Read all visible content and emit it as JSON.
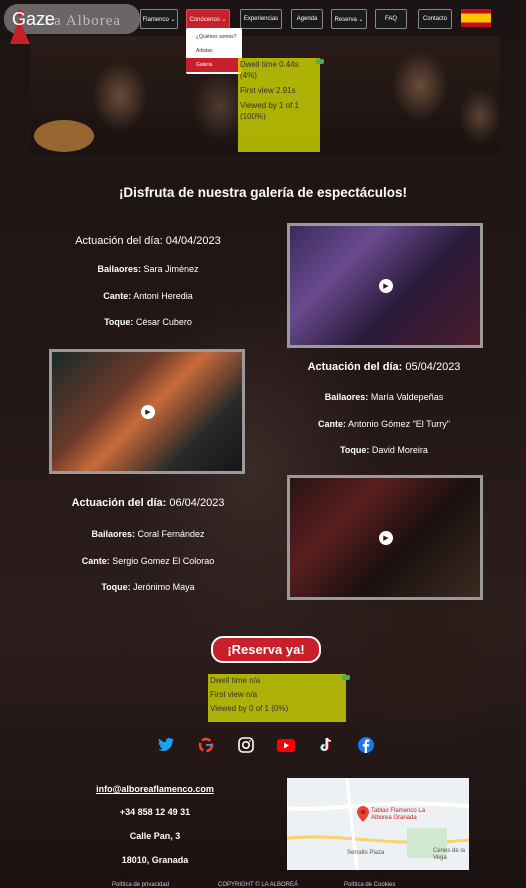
{
  "header": {
    "gaze_label": "Gaze",
    "brand": "La Alborea",
    "nav": [
      "Flamenco ⌄",
      "Conócenos ⌄",
      "Experiencias",
      "Agenda",
      "Reserva ⌄",
      "FAQ",
      "Contacto"
    ],
    "dropdown": [
      "¿Quiénes somos?",
      "Artistas",
      "Galería"
    ]
  },
  "overlay_top": {
    "dwell": "Dwell time 0.44s",
    "dwell_pct": "(4%)",
    "first": "First view 2.91s",
    "viewed": "Viewed by 1 of 1",
    "viewed_pct": "(100%)"
  },
  "overlay_bottom": {
    "dwell": "Dwell time n/a",
    "first": "First view n/a",
    "viewed": "Viewed by 0 of 1 (0%)"
  },
  "gallery": {
    "title": "¡Disfruta de nuestra galería de espectáculos!",
    "performances": [
      {
        "date_label": "Actuación del día:",
        "date": "04/04/2023",
        "bailaores_label": "Bailaores:",
        "bailaores": "Sara Jiménez",
        "cante_label": "Cante:",
        "cante": "Antoni Heredia",
        "toque_label": "Toque:",
        "toque": "César Cubero"
      },
      {
        "date_label": "Actuación del día:",
        "date": "05/04/2023",
        "bailaores_label": "Bailaores:",
        "bailaores": "María Valdepeñas",
        "cante_label": "Cante:",
        "cante": "Antonio Gómez \"El Turry\"",
        "toque_label": "Toque:",
        "toque": "David Moreira"
      },
      {
        "date_label": "Actuación del día:",
        "date": "06/04/2023",
        "bailaores_label": "Bailaores:",
        "bailaores": "Coral Fernández",
        "cante_label": "Cante:",
        "cante": "Sergio Gomez El Colorao",
        "toque_label": "Toque:",
        "toque": "Jerónimo Maya"
      }
    ]
  },
  "reserve_label": "¡Reserva ya!",
  "footer": {
    "email": "info@alboreaflamenco.com",
    "phone": "+34 858 12 49 31",
    "street": "Calle Pan, 3",
    "city": "18010, Granada",
    "map_place": "Tablao Flamenco La Alborea Granada",
    "map_area1": "Serrallo Plaza",
    "map_area2": "Cenes de la Vega",
    "legal": [
      "Política de privacidad",
      "COPYRIGHT © LA ALBOREÁ",
      "Política de Cookies"
    ]
  }
}
